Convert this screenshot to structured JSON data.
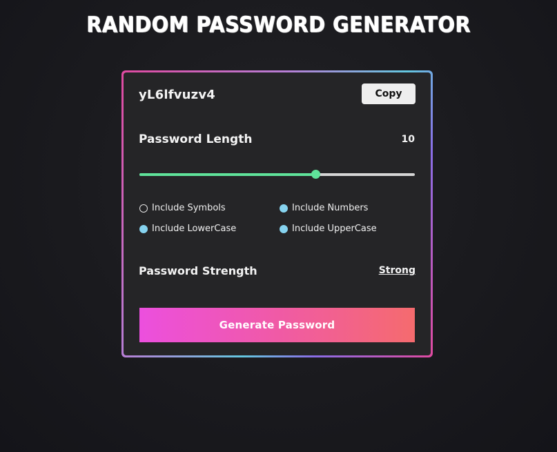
{
  "header": {
    "title": "RANDOM PASSWORD GENERATOR"
  },
  "generator": {
    "password": "yL6lfvuzv4",
    "copy_label": "Copy",
    "length_label": "Password Length",
    "length_value": "10",
    "slider_fraction": 0.64,
    "options": [
      {
        "label": "Include Symbols",
        "checked": false
      },
      {
        "label": "Include Numbers",
        "checked": true
      },
      {
        "label": "Include LowerCase",
        "checked": true
      },
      {
        "label": "Include UpperCase",
        "checked": true
      }
    ],
    "strength_label": "Password Strength",
    "strength_value": "Strong",
    "generate_label": "Generate Password"
  },
  "colors": {
    "slider_accent": "#5fe39a",
    "radio_on": "#86d3ef",
    "button_gradient_start": "#ec4fde",
    "button_gradient_end": "#f56b6e"
  }
}
